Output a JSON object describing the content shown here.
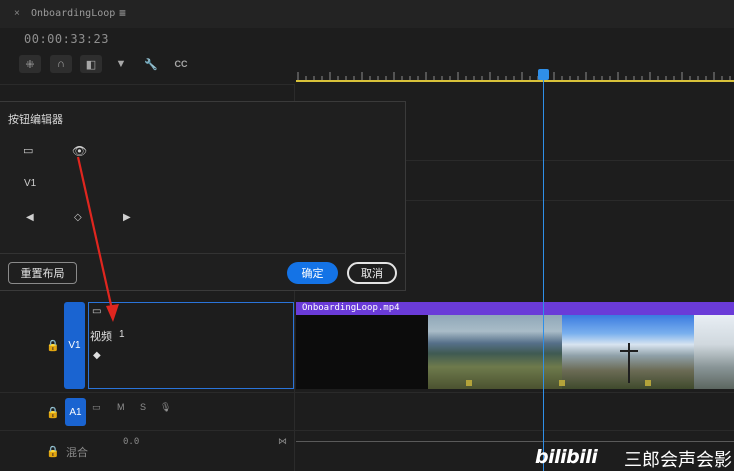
{
  "sequence_tab": {
    "close_glyph": "×",
    "title": "OnboardingLoop",
    "menu_glyph": "≡"
  },
  "timecode": "00:00:33:23",
  "toolbar": [
    {
      "name": "snap-icon",
      "glyph": "⁜"
    },
    {
      "name": "magnet-icon",
      "glyph": "∩"
    },
    {
      "name": "linked-selection-icon",
      "glyph": "◧"
    },
    {
      "name": "add-marker-icon",
      "glyph": "▼"
    },
    {
      "name": "wrench-icon",
      "glyph": "🔧"
    },
    {
      "name": "captions-icon",
      "glyph": "CC"
    }
  ],
  "button_editor": {
    "title": "按钮编辑器",
    "icons": {
      "camera": "▭",
      "eye": "👁",
      "prev": "◀",
      "keyframe": "◇",
      "next": "▶"
    },
    "track_label": "V1",
    "reset_label": "重置布局",
    "ok_label": "确定",
    "cancel_label": "取消"
  },
  "tracks": {
    "v1": {
      "lock_glyph": "🔒",
      "target_label": "V1",
      "camera_glyph": "▭",
      "name": "视频",
      "number": "1",
      "keyframe_glyph": "◆"
    },
    "a1": {
      "lock_glyph": "🔒",
      "target_label": "A1",
      "mute_label": "M",
      "solo_label": "S",
      "voiceover_glyph": "🎙"
    },
    "mix": {
      "lock_glyph": "🔒",
      "label": "混合",
      "value": "0.0",
      "end_glyph": "⋈"
    }
  },
  "clip": {
    "name": "OnboardingLoop.mp4"
  },
  "watermark": {
    "logo": "bilibili",
    "text": "三郎会声会影"
  },
  "colors": {
    "accent": "#1473e6",
    "track_target": "#1a64d1",
    "clip_label": "#6a3bd8",
    "playhead": "#2f8fe8",
    "work_area": "#d8c23a",
    "annotation": "#e0261f"
  }
}
